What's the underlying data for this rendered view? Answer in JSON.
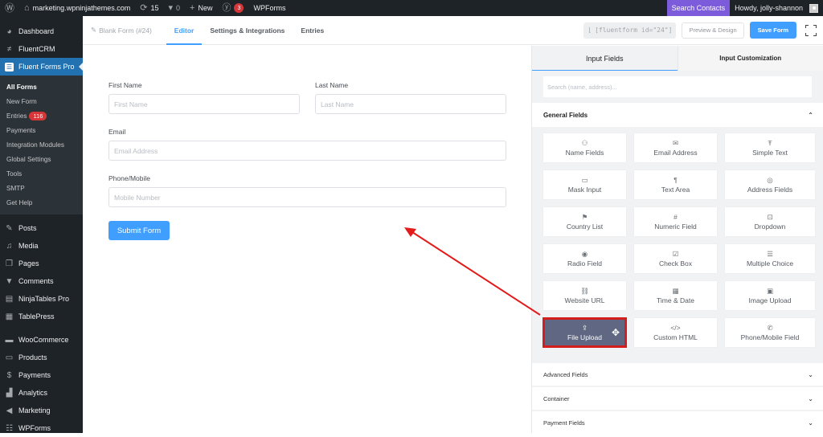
{
  "adminbar": {
    "wp_logo": "wordpress-icon",
    "site": "marketing.wpninjathemes.com",
    "updates_count": "15",
    "comments_count": "0",
    "new_label": "New",
    "yoast_badge": "3",
    "wpforms_label": "WPForms",
    "search_contacts": "Search Contacts",
    "howdy": "Howdy, jolly-shannon"
  },
  "sidebar": {
    "top_items": [
      {
        "label": "Dashboard",
        "icon": "dashboard-icon"
      },
      {
        "label": "FluentCRM",
        "icon": "fluentcrm-icon"
      },
      {
        "label": "Fluent Forms Pro",
        "icon": "fluent-forms-icon"
      }
    ],
    "submenu": [
      {
        "label": "All Forms"
      },
      {
        "label": "New Form"
      },
      {
        "label": "Entries",
        "count": "116"
      },
      {
        "label": "Payments"
      },
      {
        "label": "Integration Modules"
      },
      {
        "label": "Global Settings"
      },
      {
        "label": "Tools"
      },
      {
        "label": "SMTP"
      },
      {
        "label": "Get Help"
      }
    ],
    "bottom_items": [
      {
        "label": "Posts",
        "icon": "pin-icon"
      },
      {
        "label": "Media",
        "icon": "media-icon"
      },
      {
        "label": "Pages",
        "icon": "pages-icon"
      },
      {
        "label": "Comments",
        "icon": "comment-icon"
      },
      {
        "label": "NinjaTables Pro",
        "icon": "table-icon"
      },
      {
        "label": "TablePress",
        "icon": "tablepress-icon"
      },
      {
        "label": "WooCommerce",
        "icon": "woo-icon"
      },
      {
        "label": "Products",
        "icon": "archive-icon"
      },
      {
        "label": "Payments",
        "icon": "dollar-icon"
      },
      {
        "label": "Analytics",
        "icon": "chart-icon"
      },
      {
        "label": "Marketing",
        "icon": "megaphone-icon"
      },
      {
        "label": "WPForms",
        "icon": "form-icon"
      }
    ]
  },
  "topbar": {
    "form_title": "Blank Form (#24)",
    "tabs": [
      "Editor",
      "Settings & Integrations",
      "Entries"
    ],
    "active_tab": "Editor",
    "shortcode": "[fluentform id=\"24\"]",
    "preview_label": "Preview & Design",
    "save_label": "Save Form"
  },
  "form": {
    "first_name_label": "First Name",
    "first_name_placeholder": "First Name",
    "last_name_label": "Last Name",
    "last_name_placeholder": "Last Name",
    "email_label": "Email",
    "email_placeholder": "Email Address",
    "phone_label": "Phone/Mobile",
    "phone_placeholder": "Mobile Number",
    "submit_label": "Submit Form"
  },
  "panel": {
    "tabs": [
      "Input Fields",
      "Input Customization"
    ],
    "active_tab": "Input Fields",
    "search_placeholder": "Search (name, address)...",
    "general_section": "General Fields",
    "fields": [
      {
        "label": "Name Fields",
        "icon": "user-icon",
        "glyph": "⚇"
      },
      {
        "label": "Email Address",
        "icon": "email-icon",
        "glyph": "✉"
      },
      {
        "label": "Simple Text",
        "icon": "text-icon",
        "glyph": "Ŧ"
      },
      {
        "label": "Mask Input",
        "icon": "keyboard-icon",
        "glyph": "▭"
      },
      {
        "label": "Text Area",
        "icon": "paragraph-icon",
        "glyph": "¶"
      },
      {
        "label": "Address Fields",
        "icon": "location-icon",
        "glyph": "◎"
      },
      {
        "label": "Country List",
        "icon": "flag-icon",
        "glyph": "⚑"
      },
      {
        "label": "Numeric Field",
        "icon": "hash-icon",
        "glyph": "#"
      },
      {
        "label": "Dropdown",
        "icon": "dropdown-icon",
        "glyph": "⊡"
      },
      {
        "label": "Radio Field",
        "icon": "radio-icon",
        "glyph": "◉"
      },
      {
        "label": "Check Box",
        "icon": "checkbox-icon",
        "glyph": "☑"
      },
      {
        "label": "Multiple Choice",
        "icon": "list-icon",
        "glyph": "☰"
      },
      {
        "label": "Website URL",
        "icon": "link-icon",
        "glyph": "⛓"
      },
      {
        "label": "Time & Date",
        "icon": "calendar-icon",
        "glyph": "▦"
      },
      {
        "label": "Image Upload",
        "icon": "image-icon",
        "glyph": "▣"
      },
      {
        "label": "File Upload",
        "icon": "upload-icon",
        "glyph": "⇪",
        "dragging": true
      },
      {
        "label": "Custom HTML",
        "icon": "code-icon",
        "glyph": "</>"
      },
      {
        "label": "Phone/Mobile Field",
        "icon": "phone-icon",
        "glyph": "✆"
      }
    ],
    "accordions": [
      "Advanced Fields",
      "Container",
      "Payment Fields"
    ]
  },
  "annotation": {
    "arrow_color": "#e31b1b",
    "highlight_color": "#d41e1e"
  }
}
